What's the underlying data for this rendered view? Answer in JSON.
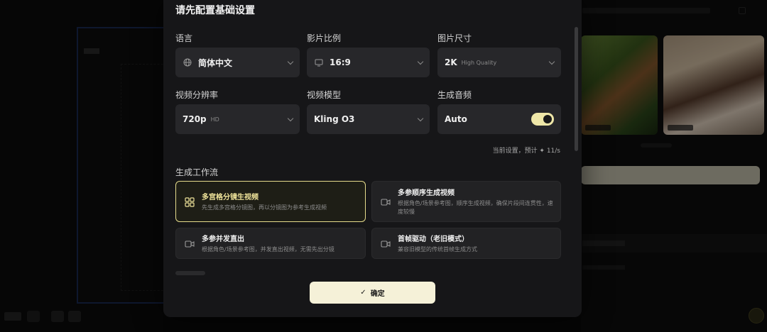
{
  "modal": {
    "title": "请先配置基础设置",
    "fields": {
      "language": {
        "label": "语言",
        "value": "简体中文",
        "icon": "globe-icon"
      },
      "aspect_ratio": {
        "label": "影片比例",
        "value": "16:9",
        "icon": "monitor-icon"
      },
      "image_size": {
        "label": "图片尺寸",
        "value": "2K",
        "sub": "High Quality"
      },
      "video_resolution": {
        "label": "视频分辨率",
        "value": "720p",
        "sub": "HD"
      },
      "video_model": {
        "label": "视频模型",
        "value": "Kling O3"
      },
      "audio": {
        "label": "生成音频",
        "value": "Auto",
        "enabled": true
      }
    },
    "estimate": "当前设置，预计 ✦ 11/s",
    "workflow": {
      "label": "生成工作流",
      "options": [
        {
          "title": "多宫格分镜生视频",
          "desc": "先生成多宫格分镜图，再以分镜图为参考生成视频",
          "icon": "grid-icon",
          "selected": true
        },
        {
          "title": "多参顺序生成视频",
          "desc": "根据角色/场景参考图，顺序生成视频，确保片段间连贯性，速度较慢",
          "icon": "video-icon",
          "selected": false
        },
        {
          "title": "多参并发直出",
          "desc": "根据角色/场景参考图，并发直出视频，无需先出分镜",
          "icon": "video-icon",
          "selected": false
        },
        {
          "title": "首帧驱动（老旧模式）",
          "desc": "兼容旧模型的传统首帧生成方式",
          "icon": "video-icon",
          "selected": false
        }
      ]
    },
    "confirm_label": "确定",
    "colors": {
      "accent": "#efe7a8",
      "modal_bg": "#161618",
      "field_bg": "#27272a"
    }
  }
}
